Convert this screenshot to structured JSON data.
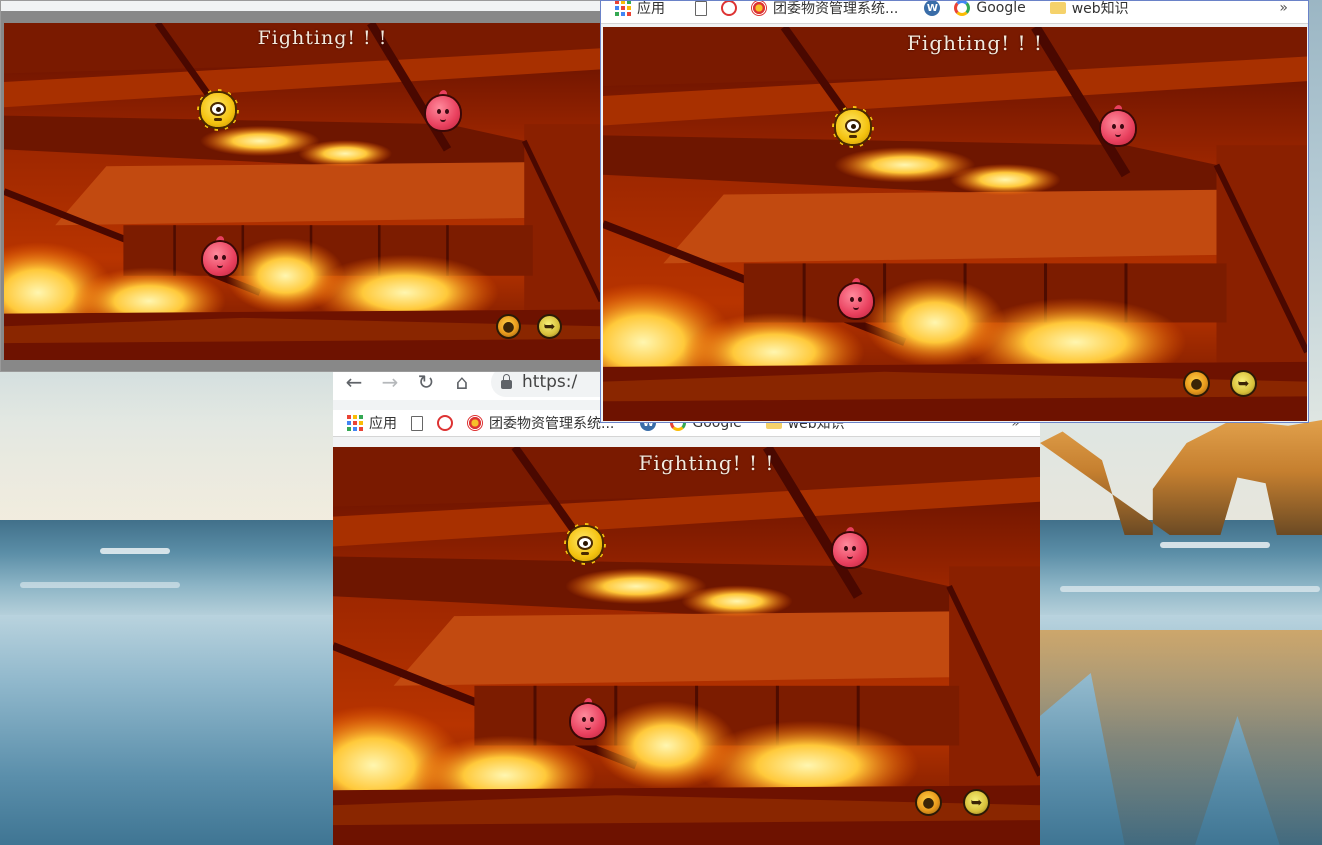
{
  "game": {
    "banner": "Fighting! ! !",
    "monsters": [
      {
        "kind": "yellow-one-eyed-monster",
        "color": "#f4c20f"
      },
      {
        "kind": "pink-blob-monster",
        "color": "#e9405e"
      },
      {
        "kind": "pink-blob-monster",
        "color": "#e9405e"
      }
    ],
    "skills": [
      {
        "icon": "fire-orb-icon"
      },
      {
        "icon": "run-away-icon"
      }
    ]
  },
  "browser": {
    "omnibox_text": "https:/",
    "bookmarks": [
      {
        "icon": "apps-grid-icon",
        "label": "应用"
      },
      {
        "icon": "page-icon",
        "label": ""
      },
      {
        "icon": "red-emblem-icon",
        "label": ""
      },
      {
        "icon": "site-favicon-icon",
        "label": "团委物资管理系统..."
      },
      {
        "icon": "wordpress-icon",
        "label": ""
      },
      {
        "icon": "google-icon",
        "label": "Google"
      },
      {
        "icon": "folder-icon",
        "label": "web知识"
      }
    ],
    "overflow": "»"
  }
}
